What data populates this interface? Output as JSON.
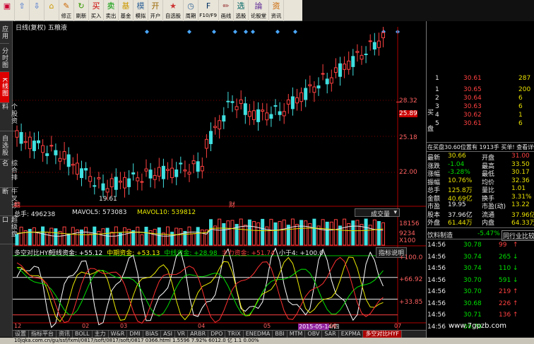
{
  "toolbar": {
    "buttons": [
      {
        "label": "",
        "icon": "stock-icon"
      },
      {
        "label": "",
        "icon": "up-icon"
      },
      {
        "label": "",
        "icon": "down-icon"
      },
      {
        "label": "",
        "icon": "home-icon"
      },
      {
        "label": "修正",
        "icon": "fix-icon"
      },
      {
        "label": "刷新",
        "icon": "refresh-icon"
      },
      {
        "label": "买入",
        "icon": "buy-icon"
      },
      {
        "label": "卖出",
        "icon": "sell-icon"
      },
      {
        "label": "基金",
        "icon": "fund-icon"
      },
      {
        "label": "模拟",
        "icon": "sim-icon"
      },
      {
        "label": "开户",
        "icon": "account-icon"
      },
      {
        "label": "自选股",
        "icon": "watchlist-icon"
      },
      {
        "label": "周期",
        "icon": "period-icon"
      },
      {
        "label": "F10/F9",
        "icon": "f10-icon"
      },
      {
        "label": "画线",
        "icon": "draw-icon"
      },
      {
        "label": "选股",
        "icon": "select-icon"
      },
      {
        "label": "论股堂",
        "icon": "forum-icon"
      },
      {
        "label": "资讯",
        "icon": "news-icon"
      }
    ]
  },
  "sidetabs": [
    "应用",
    "分时图",
    "K线图",
    "个股资料",
    "自选股",
    "综合排名",
    "牛叉诊断",
    "超级盘口"
  ],
  "chart": {
    "header": "日线(复权) 五粮液",
    "price_ticks": [
      "28.32",
      "25.89",
      "25.18",
      "22.00"
    ],
    "current_price": "25.89",
    "low_label": "19.61",
    "markers": [
      "糖",
      "财"
    ],
    "volume": {
      "label_total": "总手: 496238",
      "ma5": "MAVOL5: 573083",
      "ma10": "MAVOL10: 539812",
      "dropdown": "成交量",
      "ticks": [
        "18156",
        "9234",
        "X100"
      ]
    },
    "indicator": {
      "title": "多空对比HYF",
      "fields": [
        {
          "label": "短线资金: +55.12",
          "color": "#ffffff"
        },
        {
          "label": "中期资金: +53.13",
          "color": "#ffff00"
        },
        {
          "label": "中线资金: +28.98",
          "color": "#00e000"
        },
        {
          "label": "主力资金: +51.74",
          "color": "#ff4040"
        },
        {
          "label": "小于4: +100.0",
          "color": "#e8e8e8"
        }
      ],
      "help": "指标说明",
      "ticks": [
        "+100.0",
        "+66.92",
        "+33.85"
      ]
    },
    "x_labels": [
      "12",
      "02",
      "03",
      "04",
      "05",
      "2015-05-14/四",
      "06",
      "07"
    ]
  },
  "indicator_tabs": [
    "设置",
    "指标平台",
    "资讯",
    "BOLL",
    "主力",
    "W&R",
    "DMI",
    "BIAS",
    "ASI",
    "VR",
    "ARBR",
    "DPO",
    "TRIX",
    "ENEDMA",
    "BBI",
    "MTM",
    "OBV",
    "SAR",
    "EXPMA",
    "多空对比HYF"
  ],
  "statusbar": "10jqka.com.cn/gu/ssf/fxml/0817/soft/0817/soft/0817 0366.html   1.5596    7.92%  6012.0 亿  1.1  0.00%",
  "rpanel": {
    "top_rows": [
      {
        "n": "1",
        "price": "30.61",
        "vol": "287"
      },
      {
        "n": "1",
        "price": "30.65",
        "vol": "200"
      },
      {
        "n": "2",
        "price": "30.64",
        "vol": "6"
      },
      {
        "n": "3",
        "price": "30.63",
        "vol": "6"
      },
      {
        "n": "4",
        "price": "30.62",
        "vol": "1"
      },
      {
        "n": "5",
        "price": "30.61",
        "vol": "6"
      }
    ],
    "buy_label": "买",
    "plate_label": "盘",
    "order_line": "在买盘30.60位置有  1913手  买单! 查看详情",
    "quote": [
      {
        "k1": "最新",
        "v1": "30.66",
        "k2": "开盘",
        "v2": "31.00"
      },
      {
        "k1": "涨跌",
        "v1": "-1.04",
        "k2": "最高",
        "v2": "33.50"
      },
      {
        "k1": "涨幅",
        "v1": "-3.28%",
        "k2": "最低",
        "v2": "30.17"
      },
      {
        "k1": "振幅",
        "v1": "10.76%",
        "k2": "均价",
        "v2": "32.36"
      },
      {
        "k1": "总手",
        "v1": "125.8万",
        "k2": "量比",
        "v2": "1.01"
      },
      {
        "k1": "金额",
        "v1": "40.69亿",
        "k2": "换手",
        "v2": "3.31%"
      },
      {
        "k1": "市盈",
        "v1": "19.95",
        "k2": "市盈(动)",
        "v2": "13.22"
      },
      {
        "k1": "股本",
        "v1": "37.96亿",
        "k2": "流通",
        "v2": "37.96亿"
      },
      {
        "k1": "外盘",
        "v1": "61.44万",
        "k2": "内盘",
        "v2": "64.33万"
      }
    ],
    "sector": {
      "name": "饮料制造",
      "change": "-5.47%",
      "link": "同行业比较"
    },
    "ticks": [
      {
        "t": "14:56",
        "p": "30.78",
        "v": "99",
        "dir": "up"
      },
      {
        "t": "14:56",
        "p": "30.74",
        "v": "265",
        "dir": "down"
      },
      {
        "t": "14:56",
        "p": "30.74",
        "v": "110",
        "dir": "down"
      },
      {
        "t": "14:56",
        "p": "30.70",
        "v": "591",
        "dir": "down"
      },
      {
        "t": "14:56",
        "p": "30.70",
        "v": "219",
        "dir": "up"
      },
      {
        "t": "14:56",
        "p": "30.68",
        "v": "226",
        "dir": "up"
      },
      {
        "t": "14:56",
        "p": "30.71",
        "v": "136",
        "dir": "up"
      },
      {
        "t": "14:56",
        "p": "30.70",
        "v": "",
        "dir": ""
      }
    ]
  },
  "watermark": "www.7gpzb.com",
  "colors": {
    "up": "#ff4040",
    "down": "#00e000",
    "grid": "#800000",
    "axis": "#b00000"
  }
}
